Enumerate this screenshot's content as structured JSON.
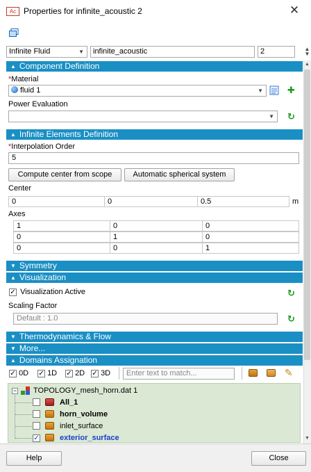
{
  "window": {
    "app_icon": "Ac",
    "title": "Properties for infinite_acoustic 2"
  },
  "toolbar": {
    "type_select": "Infinite Fluid",
    "name_value": "infinite_acoustic",
    "index_value": "2"
  },
  "component_definition": {
    "header": "Component Definition",
    "material_label": "Material",
    "material_value": "fluid 1",
    "power_label": "Power Evaluation",
    "power_value": ""
  },
  "infinite_elements": {
    "header": "Infinite Elements Definition",
    "interp_label": "Interpolation Order",
    "interp_value": "5",
    "btn_scope": "Compute center from scope",
    "btn_spherical": "Automatic spherical system",
    "center_label": "Center",
    "center": [
      "0",
      "0",
      "0.5"
    ],
    "center_unit": "m",
    "axes_label": "Axes",
    "axes": [
      [
        "1",
        "0",
        "0"
      ],
      [
        "0",
        "1",
        "0"
      ],
      [
        "0",
        "0",
        "1"
      ]
    ]
  },
  "sections": {
    "symmetry": "Symmetry",
    "visualization": "Visualization",
    "thermo": "Thermodynamics & Flow",
    "more": "More...",
    "domains": "Domains Assignation"
  },
  "visualization": {
    "active_label": "Visualization Active",
    "active_checked": true,
    "scaling_label": "Scaling Factor",
    "scaling_placeholder": "Default : 1.0"
  },
  "domains": {
    "filters": [
      {
        "label": "0D",
        "checked": true
      },
      {
        "label": "1D",
        "checked": true
      },
      {
        "label": "2D",
        "checked": true
      },
      {
        "label": "3D",
        "checked": true
      }
    ],
    "search_placeholder": "Enter text to match...",
    "tree_root": "TOPOLOGY_mesh_horn.dat 1",
    "items": [
      {
        "label": "All_1",
        "checked": false
      },
      {
        "label": "horn_volume",
        "checked": false
      },
      {
        "label": "inlet_surface",
        "checked": false
      },
      {
        "label": "exterior_surface",
        "checked": true
      }
    ]
  },
  "footer": {
    "help": "Help",
    "close": "Close"
  },
  "colors": {
    "section_header": "#1a8fc4",
    "tree_background": "#dbe9d4",
    "selected_text": "#1a3fcf"
  }
}
